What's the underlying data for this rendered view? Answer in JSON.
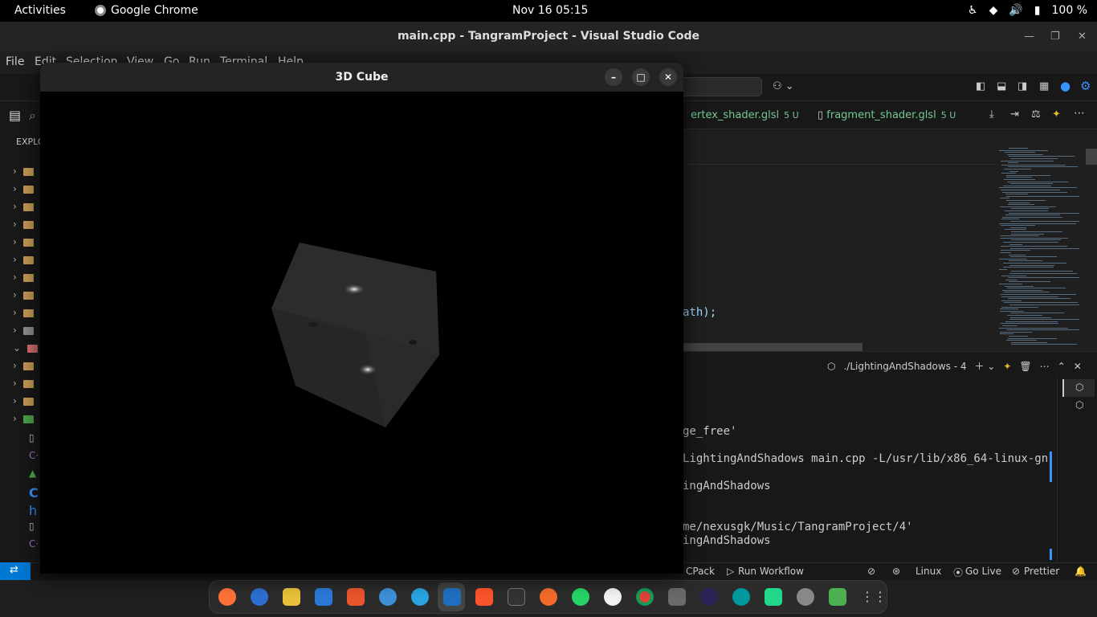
{
  "topbar": {
    "activities": "Activities",
    "app_name": "Google Chrome",
    "clock": "Nov 16  05:15",
    "battery": "100 %"
  },
  "vscode": {
    "window_title": "main.cpp - TangramProject - Visual Studio Code",
    "menu": [
      "File",
      "Edit",
      "Selection",
      "View",
      "Go",
      "Run",
      "Terminal",
      "Help"
    ],
    "explorer_label": "EXPLO",
    "tabs": [
      {
        "label": "ertex_shader.glsl",
        "badge": "5 U"
      },
      {
        "label": "fragment_shader.glsl",
        "badge": "5 U"
      }
    ],
    "code_fragment": "ath);",
    "terminal_tab": "./LightingAndShadows - 4",
    "terminal_lines": [
      "ge_free'",
      "LightingAndShadows main.cpp -L/usr/lib/x86_64-linux-gn",
      "ingAndShadows",
      "me/nexusgk/Music/TangramProject/4'",
      "ingAndShadows"
    ],
    "status": {
      "cpack": "CPack",
      "run_workflow": "Run Workflow",
      "os": "Linux",
      "go_live": "Go Live",
      "prettier": "Prettier"
    }
  },
  "cube_window": {
    "title": "3D Cube",
    "minimize": "–",
    "maximize": "□",
    "close": "✕"
  },
  "colors": {
    "accent": "#0078d4",
    "git_untracked": "#73c991"
  }
}
